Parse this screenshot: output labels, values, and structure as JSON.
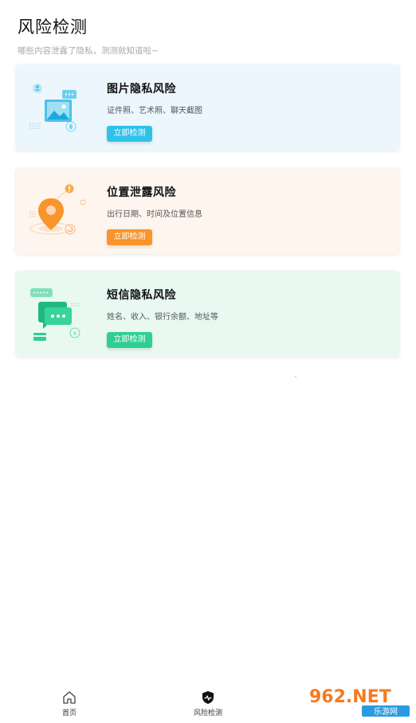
{
  "header": {
    "title": "风险检测",
    "subtitle": "哪些内容泄露了隐私，测测就知道啦~"
  },
  "cards": [
    {
      "title": "图片隐私风险",
      "desc": "证件照、艺术照、聊天截图",
      "button": "立即检测",
      "icon": "image-privacy-illustration",
      "accent": "#2dc2ea"
    },
    {
      "title": "位置泄露风险",
      "desc": "出行日期、时间及位置信息",
      "button": "立即检测",
      "icon": "location-pin-illustration",
      "accent": "#f9952a"
    },
    {
      "title": "短信隐私风险",
      "desc": "姓名、收入、银行余额、地址等",
      "button": "立即检测",
      "icon": "sms-chat-illustration",
      "accent": "#2fcf92"
    }
  ],
  "tabbar": {
    "items": [
      {
        "label": "首页",
        "icon": "home-icon"
      },
      {
        "label": "风险检测",
        "icon": "shield-pulse-icon"
      }
    ]
  },
  "watermark": {
    "text": "962.NET",
    "subtext": "乐游网"
  }
}
